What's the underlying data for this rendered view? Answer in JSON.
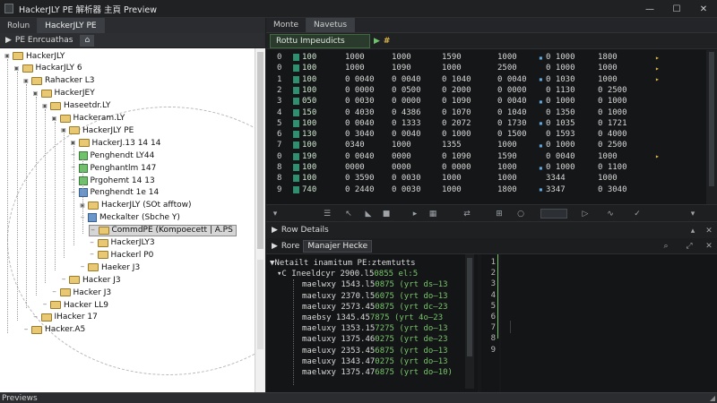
{
  "window": {
    "title": "HackerJLY PE 解析器 主頁 Preview",
    "controls": {
      "minimize": "—",
      "maximize": "☐",
      "close": "✕"
    }
  },
  "left": {
    "tabs": [
      "Rolun",
      "HackerJLY PE"
    ],
    "toolbar_label": "PE Enrcuathas",
    "toolbar_icon": "tree-view-icon",
    "star": "★",
    "tree": [
      {
        "label": "HackerJLY",
        "depth": 0,
        "type": "folder",
        "open": true
      },
      {
        "label": "HackarJLY 6",
        "depth": 1,
        "type": "folder",
        "open": true
      },
      {
        "label": "Rahacker L3",
        "depth": 2,
        "type": "folder",
        "open": true
      },
      {
        "label": "HackerJEY",
        "depth": 3,
        "type": "folder",
        "open": true
      },
      {
        "label": "Haseetdr.LY",
        "depth": 4,
        "type": "folder",
        "open": true
      },
      {
        "label": "Hackeram.LY",
        "depth": 5,
        "type": "folder",
        "open": true
      },
      {
        "label": "HackerJLY PE",
        "depth": 6,
        "type": "folder",
        "open": true
      },
      {
        "label": "HackerJ.13 14 14",
        "depth": 7,
        "type": "folder",
        "open": true
      },
      {
        "label": "Penghendt LY44",
        "depth": 7,
        "type": "green"
      },
      {
        "label": "Penghantlm 147",
        "depth": 7,
        "type": "green"
      },
      {
        "label": "Prgohemt 14 13",
        "depth": 7,
        "type": "green"
      },
      {
        "label": "Penghendt 1e 14",
        "depth": 7,
        "type": "blue"
      },
      {
        "label": "HackerJLY (SOt afftow)",
        "depth": 8,
        "type": "folder",
        "open": true
      },
      {
        "label": "Meckalter (Sbche Y)",
        "depth": 8,
        "type": "blue"
      },
      {
        "label": "CommdPE (Kompoecett | A.PS",
        "depth": 9,
        "type": "folder",
        "selected": true
      },
      {
        "label": "HackerJLY3",
        "depth": 9,
        "type": "folder"
      },
      {
        "label": "Hackerl P0",
        "depth": 9,
        "type": "folder"
      },
      {
        "label": "Haeker J3",
        "depth": 8,
        "type": "folder"
      },
      {
        "label": "Hacker J3",
        "depth": 6,
        "type": "folder"
      },
      {
        "label": "Hacker J3",
        "depth": 5,
        "type": "folder"
      },
      {
        "label": "Hacker LL9",
        "depth": 4,
        "type": "folder"
      },
      {
        "label": "IHacker 17",
        "depth": 3,
        "type": "folder"
      },
      {
        "label": "Hacker.A5",
        "depth": 2,
        "type": "folder"
      }
    ]
  },
  "right": {
    "tabs": [
      "Monte",
      "Navetus"
    ],
    "section_label": "Rottu Impeudicts",
    "arrow": "▶",
    "hash": "#",
    "grid": [
      {
        "idx": "0",
        "c1": "100",
        "c2": "1000",
        "c3": "1000",
        "c4": "1590",
        "c5": "1000",
        "c6": "0 1000",
        "c7": "1800"
      },
      {
        "idx": "0",
        "c1": "100",
        "c2": "1000",
        "c3": "1090",
        "c4": "1000",
        "c5": "2500",
        "c6": "0 1000",
        "c7": "1000"
      },
      {
        "idx": "1",
        "c1": "100",
        "c2": "0 0040",
        "c3": "0 0040",
        "c4": "0 1040",
        "c5": "0 0040",
        "c6": "0 1030",
        "c7": "1000"
      },
      {
        "idx": "2",
        "c1": "100",
        "c2": "0 0000",
        "c3": "0 0500",
        "c4": "0 2000",
        "c5": "0 0000",
        "c6": "0 1130",
        "c7": "0 2500"
      },
      {
        "idx": "3",
        "c1": "050",
        "c2": "0 0030",
        "c3": "0 0000",
        "c4": "0 1090",
        "c5": "0 0040",
        "c6": "0 1000",
        "c7": "0 1000"
      },
      {
        "idx": "4",
        "c1": "150",
        "c2": "0 4030",
        "c3": "0 4386",
        "c4": "0 1070",
        "c5": "0 1040",
        "c6": "0 1350",
        "c7": "0 1000"
      },
      {
        "idx": "5",
        "c1": "100",
        "c2": "0 0040",
        "c3": "0 1333",
        "c4": "0 2072",
        "c5": "0 1730",
        "c6": "0 1035",
        "c7": "0 1721"
      },
      {
        "idx": "6",
        "c1": "130",
        "c2": "0 3040",
        "c3": "0 0040",
        "c4": "0 1000",
        "c5": "0 1500",
        "c6": "0 1593",
        "c7": "0 4000"
      },
      {
        "idx": "7",
        "c1": "100",
        "c2": "0340",
        "c3": "1000",
        "c4": "1355",
        "c5": "1000",
        "c6": "0 1000",
        "c7": "0 2500"
      },
      {
        "idx": "0",
        "c1": "190",
        "c2": "0 0040",
        "c3": "0000",
        "c4": "0 1090",
        "c5": "1590",
        "c6": "0 0040",
        "c7": "1000"
      },
      {
        "idx": "8",
        "c1": "100",
        "c2": "0000",
        "c3": "0000",
        "c4": "0 0000",
        "c5": "1000",
        "c6": "0 1000",
        "c7": "0 1100"
      },
      {
        "idx": "8",
        "c1": "100",
        "c2": "0 3590",
        "c3": "0 0030",
        "c4": "1000",
        "c5": "1000",
        "c6": "3344",
        "c7": "1000"
      },
      {
        "idx": "9",
        "c1": "740",
        "c2": "0 2440",
        "c3": "0 0030",
        "c4": "1000",
        "c5": "1800",
        "c6": "3347",
        "c7": "0 3040"
      }
    ],
    "details_tab": "Row Details",
    "details_bar_label": "Rore",
    "details_bar_chip": "Manajer Hecke",
    "details_header": "Netailt inamitum PE:ztemtutts",
    "details_root": "C Ineeldcyr 2900.l5",
    "details_root_val": "0855 el:5",
    "details_items": [
      {
        "k": "maelwxy 1543.l5",
        "v": "0875 (yrt ds—13"
      },
      {
        "k": "maeluxy 2370.l5",
        "v": "6075 (yrt do—13"
      },
      {
        "k": "maeluxy 2573.45",
        "v": "0875 (yrt dc—23"
      },
      {
        "k": "maebsy 1345.45",
        "v": "7875 (yrt 4o—23"
      },
      {
        "k": "maeluxy 1353.15",
        "v": "7275 (yrt do—13"
      },
      {
        "k": "maeluxy 1375.46",
        "v": "0275 (yrt de—23"
      },
      {
        "k": "maeluxy 2353.45",
        "v": "6875 (yrt do—13"
      },
      {
        "k": "maeluxy 1343.47",
        "v": "0275 (yrt do—13"
      },
      {
        "k": "maelwxy 1375.47",
        "v": "6875 (yrt do—10)"
      }
    ],
    "gutter": [
      "1",
      "2",
      "3",
      "4",
      "5",
      "6",
      "7",
      "8",
      "9"
    ]
  },
  "status": {
    "text": "Previews",
    "grip": "◢"
  }
}
